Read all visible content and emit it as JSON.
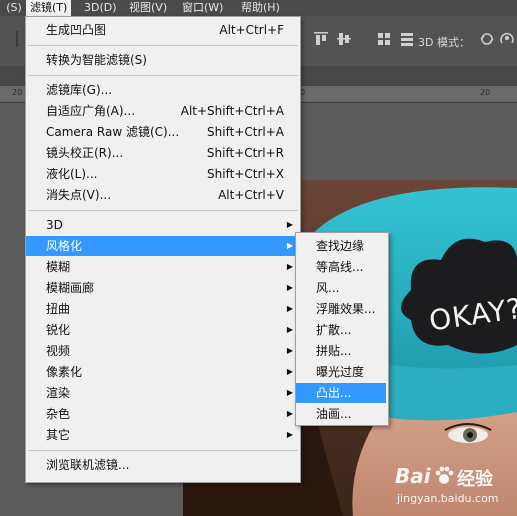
{
  "menubar": {
    "items": [
      " (S)",
      "滤镜(T)",
      "3D(D)",
      "视图(V)",
      "窗口(W)",
      "帮助(H)"
    ]
  },
  "optionsbar": {
    "mode_label": "3D 模式："
  },
  "ruler": {
    "ticks": [
      "20",
      "0",
      "20"
    ]
  },
  "filter_menu": {
    "last_filter": {
      "label": "生成凹凸图",
      "shortcut": "Alt+Ctrl+F"
    },
    "convert": {
      "label": "转换为智能滤镜(S)"
    },
    "group1": [
      {
        "label": "滤镜库(G)...",
        "shortcut": ""
      },
      {
        "label": "自适应广角(A)...",
        "shortcut": "Alt+Shift+Ctrl+A"
      },
      {
        "label": "Camera Raw 滤镜(C)...",
        "shortcut": "Shift+Ctrl+A"
      },
      {
        "label": "镜头校正(R)...",
        "shortcut": "Shift+Ctrl+R"
      },
      {
        "label": "液化(L)...",
        "shortcut": "Shift+Ctrl+X"
      },
      {
        "label": "消失点(V)...",
        "shortcut": "Alt+Ctrl+V"
      }
    ],
    "submenus": [
      "3D",
      "风格化",
      "模糊",
      "模糊画廊",
      "扭曲",
      "锐化",
      "视频",
      "像素化",
      "渲染",
      "杂色",
      "其它"
    ],
    "browse": {
      "label": "浏览联机滤镜..."
    }
  },
  "stylize_submenu": {
    "items": [
      "查找边缘",
      "等高线...",
      "风...",
      "浮雕效果...",
      "扩散...",
      "拼贴...",
      "曝光过度",
      "凸出...",
      "油画..."
    ],
    "highlighted_index": 7
  },
  "photo": {
    "beanie_text": "OKAY?"
  },
  "watermark": {
    "brand": "Bai",
    "brand2": "经验",
    "url": "jingyan.baidu.com"
  },
  "colors": {
    "highlight": "#3399ff",
    "menu_bg": "#f0f0f0",
    "beanie": "#2ab3c6"
  }
}
